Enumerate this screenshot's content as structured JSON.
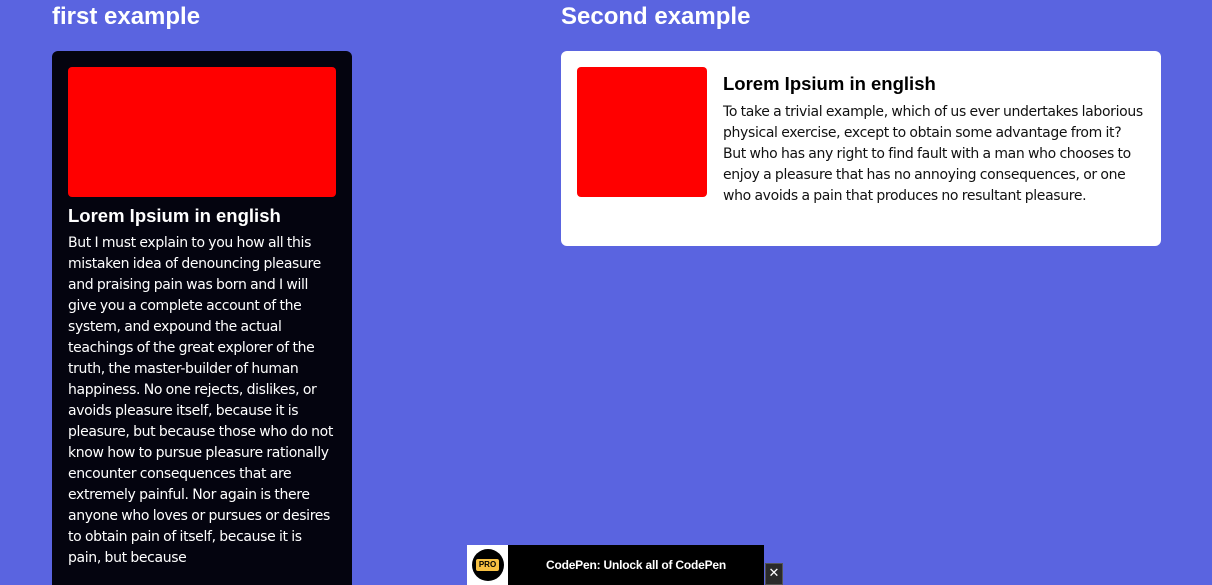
{
  "first_example": {
    "heading": "first example",
    "card": {
      "title": "Lorem Ipsium in english",
      "text": "But I must explain to you how all this mistaken idea of denouncing pleasure and praising pain was born and I will give you a complete account of the system, and expound the actual teachings of the great explorer of the truth, the master-builder of human happiness. No one rejects, dislikes, or avoids pleasure itself, because it is pleasure, but because those who do not know how to pursue pleasure rationally encounter consequences that are extremely painful. Nor again is there anyone who loves or pursues or desires to obtain pain of itself, because it is pain, but because"
    }
  },
  "second_example": {
    "heading": "Second example",
    "card": {
      "title": "Lorem Ipsium in english",
      "text": "To take a trivial example, which of us ever undertakes laborious physical exercise, except to obtain some advantage from it? But who has any right to find fault with a man who chooses to enjoy a pleasure that has no annoying consequences, or one who avoids a pain that produces no resultant pleasure."
    }
  },
  "promo": {
    "badge": "PRO",
    "text": "CodePen: Unlock all of CodePen",
    "close": "✕"
  },
  "colors": {
    "background": "#5a64e0",
    "dark_card": "#04040f",
    "light_card": "#ffffff",
    "thumbnail": "#ff0000",
    "pro_badge": "#f7c042"
  }
}
